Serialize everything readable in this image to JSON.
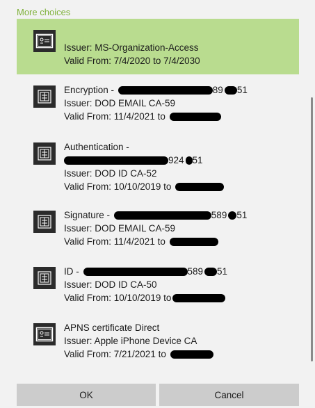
{
  "heading": "More choices",
  "colors": {
    "accent": "#7fb13a",
    "selected_bg": "#b9dc8f",
    "icon_bg": "#2b2b2b",
    "button_bg": "#cccccc",
    "page_bg": "#f2f2f2"
  },
  "certificates": [
    {
      "title": "",
      "issuer": "Issuer: MS-Organization-Access",
      "valid": "Valid From: 7/4/2020 to 7/4/2030",
      "icon": "certificate-icon",
      "selected": true
    },
    {
      "title": "Encryption - ",
      "title_tail": "89",
      "title_tail2": "51",
      "issuer": "Issuer: DOD EMAIL CA-59",
      "valid": "Valid From: 11/4/2021 to ",
      "icon": "certificate-icon",
      "selected": false
    },
    {
      "title": "Authentication -",
      "id_tail": "924",
      "id_tail2": "51",
      "issuer": "Issuer: DOD ID CA-52",
      "valid": "Valid From: 10/10/2019 to ",
      "icon": "certificate-icon",
      "selected": false
    },
    {
      "title": "Signature - ",
      "title_tail": "589",
      "title_tail2": "51",
      "issuer": "Issuer: DOD EMAIL CA-59",
      "valid": "Valid From: 11/4/2021 to ",
      "icon": "certificate-icon",
      "selected": false
    },
    {
      "title": "ID - ",
      "title_tail": "589",
      "title_tail2": "51",
      "issuer": "Issuer: DOD ID CA-50",
      "valid": "Valid From: 10/10/2019 to",
      "icon": "certificate-icon",
      "selected": false
    },
    {
      "title": "APNS certificate Direct",
      "issuer": "Issuer: Apple iPhone Device CA",
      "valid": "Valid From: 7/21/2021 to ",
      "icon": "certificate-icon",
      "selected": false
    }
  ],
  "buttons": {
    "ok": "OK",
    "cancel": "Cancel"
  }
}
